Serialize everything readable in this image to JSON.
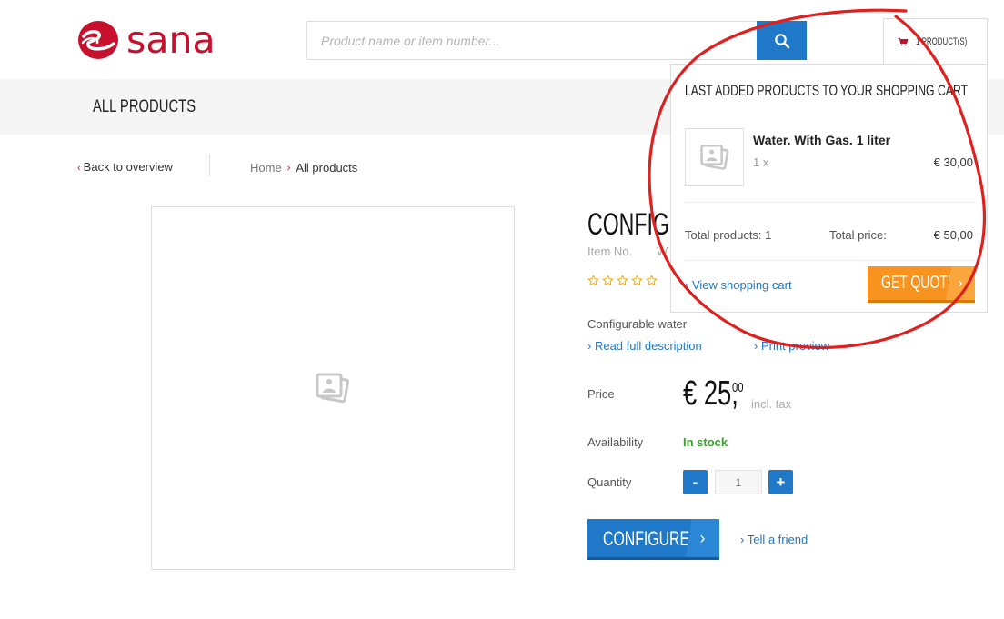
{
  "header": {
    "logo_text": "sana",
    "search": {
      "placeholder": "Product name or item number..."
    },
    "cart": {
      "count_label": "1 PRODUCT(S)"
    }
  },
  "nav": {
    "items": [
      {
        "label": "ALL PRODUCTS"
      }
    ]
  },
  "breadcrumb": {
    "back_label": "Back to overview",
    "items": [
      {
        "label": "Home"
      },
      {
        "label": "All products"
      }
    ]
  },
  "product": {
    "title_visible": "CONFIGU",
    "item_no_label": "Item No.",
    "item_no_value": "W",
    "rating": {
      "value": 0,
      "max": 5
    },
    "short_description": "Configurable water",
    "read_full_label": "Read full description",
    "print_preview_label": "Print preview",
    "price_label": "Price",
    "price_main": "€ 25,",
    "price_decimals": "00",
    "incl_tax": "incl. tax",
    "availability_label": "Availability",
    "availability_value": "In stock",
    "quantity_label": "Quantity",
    "quantity_value": "1",
    "qty_minus": "-",
    "qty_plus": "+",
    "configure_label": "CONFIGURE",
    "tell_friend_label": "Tell a friend"
  },
  "minicart": {
    "heading": "LAST ADDED PRODUCTS TO YOUR SHOPPING CART",
    "items": [
      {
        "name": "Water. With Gas. 1 liter",
        "qty": "1 x",
        "price": "€ 30,00"
      }
    ],
    "total_products_label": "Total products: 1",
    "total_price_label": "Total price:",
    "total_price_value": "€ 50,00",
    "view_cart_label": "View shopping cart",
    "get_quote_label": "GET QUOTE"
  },
  "colors": {
    "brand_red": "#c8102e",
    "primary_blue": "#1f78c8",
    "quote_orange": "#f7931e",
    "in_stock_green": "#3aa32f",
    "annotation_red": "#e0201e"
  },
  "icons": [
    "sana-logo-icon",
    "search-icon",
    "cart-icon",
    "image-placeholder-icon",
    "star-icon",
    "chevron-right-icon"
  ]
}
